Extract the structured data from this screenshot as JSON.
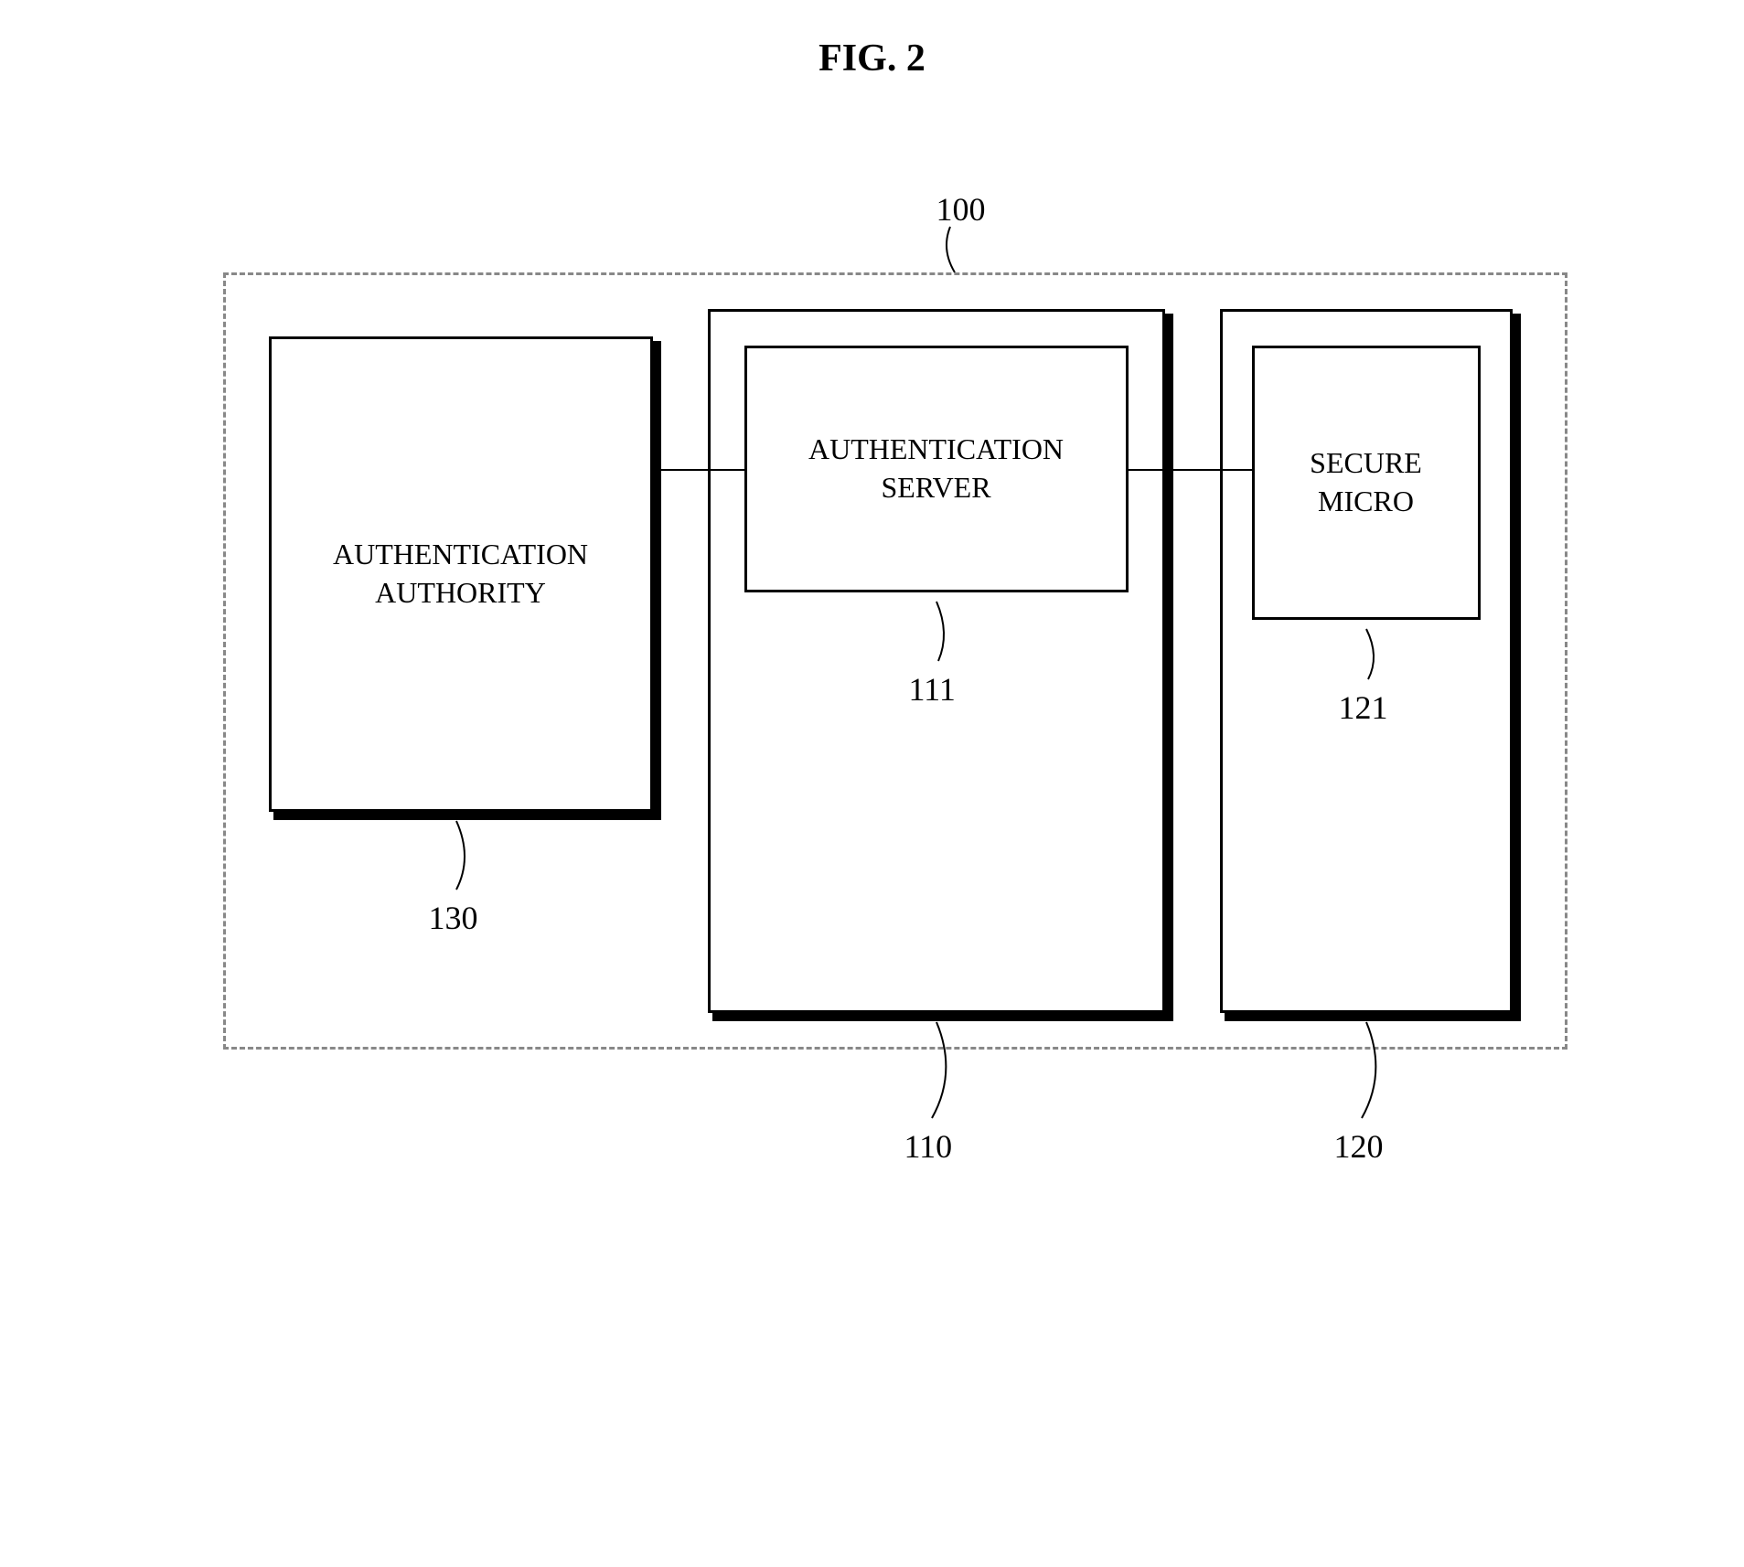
{
  "title": "FIG. 2",
  "labels": {
    "container": "100",
    "head_end": "110",
    "auth_authority": "130",
    "auth_server": "111",
    "host": "120",
    "secure_micro": "121"
  },
  "boxes": {
    "auth_authority": "AUTHENTICATION\nAUTHORITY",
    "auth_server": "AUTHENTICATION\nSERVER",
    "secure_micro": "SECURE\nMICRO"
  }
}
